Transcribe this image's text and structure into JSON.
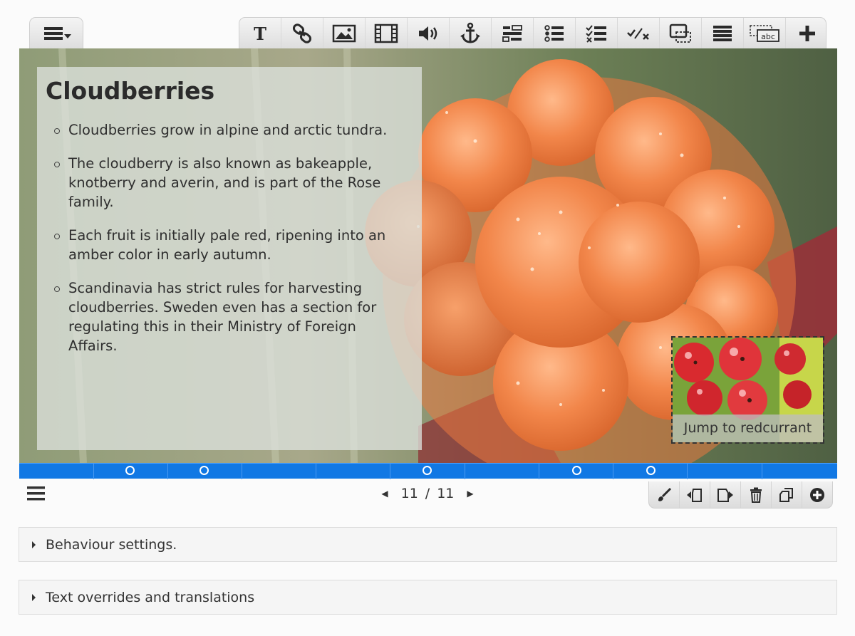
{
  "editor": {
    "menu_icon": "hamburger-dropdown-icon",
    "toolbar": [
      {
        "id": "text",
        "icon": "text-icon"
      },
      {
        "id": "link",
        "icon": "link-icon"
      },
      {
        "id": "image",
        "icon": "image-icon"
      },
      {
        "id": "video",
        "icon": "video-icon"
      },
      {
        "id": "audio",
        "icon": "audio-icon"
      },
      {
        "id": "hotspot",
        "icon": "anchor-icon"
      },
      {
        "id": "fill-in",
        "icon": "fill-in-blanks-icon"
      },
      {
        "id": "single-choice",
        "icon": "list-choice-icon"
      },
      {
        "id": "multi-choice",
        "icon": "checklist-icon"
      },
      {
        "id": "true-false",
        "icon": "true-false-icon"
      },
      {
        "id": "drag",
        "icon": "drag-drop-icon"
      },
      {
        "id": "summary",
        "icon": "summary-list-icon"
      },
      {
        "id": "dropdown",
        "icon": "text-input-abc-icon"
      },
      {
        "id": "more",
        "icon": "plus-icon"
      }
    ]
  },
  "slide": {
    "title": "Cloudberries",
    "bullets": [
      "Cloudberries grow in alpine and arctic tundra.",
      "The cloudberry is also known as bakeapple, knotberry and averin, and is part of the Rose family.",
      "Each fruit is initially pale red, ripening into an amber color in early autumn.",
      "Scandinavia has strict rules for harvesting cloudberries. Sweden even has a section for regulating this in their Ministry of Foreign Affairs."
    ],
    "hotspot": {
      "label": "Jump to redcurrant"
    }
  },
  "colors": {
    "progress_bar": "#1178e4",
    "berry": "#f08a4b",
    "textbox_bg": "#dce2dc"
  },
  "navigation": {
    "current_slide": "11",
    "separator": "/",
    "total_slides": "11",
    "slide_actions": [
      {
        "id": "background",
        "icon": "brush-icon"
      },
      {
        "id": "move-left",
        "icon": "move-slide-left-icon"
      },
      {
        "id": "move-right",
        "icon": "move-slide-right-icon"
      },
      {
        "id": "delete",
        "icon": "trash-icon"
      },
      {
        "id": "clone",
        "icon": "clone-icon"
      },
      {
        "id": "add",
        "icon": "add-circle-icon"
      }
    ]
  },
  "panels": [
    {
      "label": "Behaviour settings."
    },
    {
      "label": "Text overrides and translations"
    }
  ]
}
